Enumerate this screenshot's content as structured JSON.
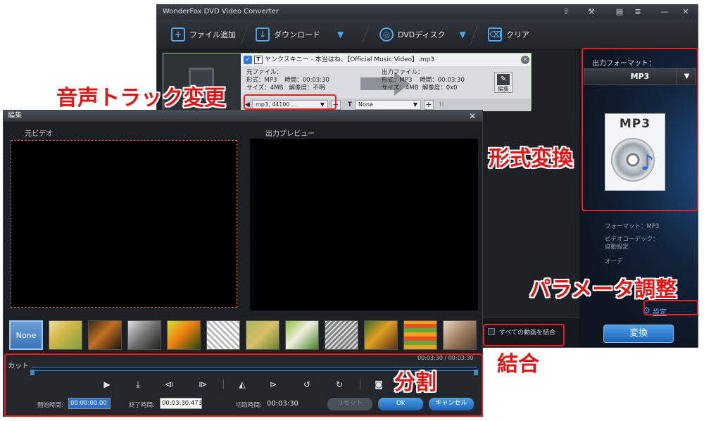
{
  "app": {
    "title": "WonderFox DVD Video Converter",
    "titlebar_icons": [
      "upload-icon",
      "tools-icon",
      "chat-icon",
      "menu-icon",
      "minimize-icon",
      "close-icon"
    ]
  },
  "toolbar": {
    "add_file": "ファイル追加",
    "download": "ダウンロード",
    "dvd": "DVDディスク",
    "clear": "クリア"
  },
  "file": {
    "name": "ヤンクスキニー - 本当はね、【Official Music Video】.mp3",
    "src_label": "元ファイル：",
    "src_format": "形式：MP3",
    "src_time": "時間：00:03:30",
    "src_size": "サイズ：4MB",
    "src_res": "解像度：不明",
    "out_label": "出力ファイル：",
    "out_format": "形式：MP3",
    "out_time": "時間：00:03:30",
    "out_size": "サイズ：4MB",
    "out_res": "解像度：0x0",
    "edit_label": "編集",
    "audio_track": "mp3, 44100 ...",
    "subtitle": "None",
    "sub_icon_label": "T",
    "extra_label": "H"
  },
  "right_panel": {
    "format_label": "出力フォーマット：",
    "format_value": "MP3",
    "format_box_text": "MP3",
    "info_format": "フォーマット：MP3",
    "info_codec": "ビデオコーデック：",
    "info_auto": "自動設定",
    "info_audio": "オーデ",
    "settings_link": "設定",
    "merge_label": "すべての動画を結合",
    "convert_button": "変換"
  },
  "edit_dialog": {
    "title": "編集",
    "source_label": "元ビデオ",
    "preview_label": "出力プレビュー",
    "none_filter": "None",
    "cut_label": "カット",
    "time_total": "00:03:30 / 00:03:30",
    "start_label": "開始時間:",
    "start_value": "00:00:00.00",
    "end_label": "終了時間:",
    "end_value": "00:03:30.473",
    "cut_time_label": "切取時間:",
    "cut_time_value": "00:03:30",
    "reset_button": "リセット",
    "ok_button": "Ok",
    "cancel_button": "キャンセル",
    "controls": [
      "play-icon",
      "mark-in-icon",
      "clip-start-icon",
      "clip-end-icon",
      "mirror-icon",
      "flip-icon",
      "rotate-left-icon",
      "rotate-right-icon",
      "snapshot-icon"
    ]
  },
  "annotations": {
    "audio_track_change": "音声トラック変更",
    "format_convert": "形式変換",
    "parameter_adjust": "パラメータ調整",
    "merge": "結合",
    "split": "分割"
  },
  "colors": {
    "accent": "#4ea6e8",
    "annotation_red": "#ee1c1c",
    "convert_blue": "#2f7ad6"
  }
}
